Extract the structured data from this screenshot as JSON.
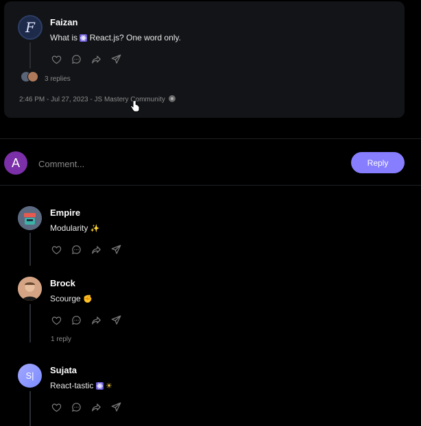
{
  "thread": {
    "author": "Faizan",
    "avatar_letter": "F",
    "text_before": "What is",
    "text_after": "React.js? One word only.",
    "replies_label": "3 replies",
    "meta_label": "2:46 PM - Jul 27, 2023 - JS Mastery Community"
  },
  "comment_form": {
    "avatar_letter": "A",
    "placeholder": "Comment...",
    "button_label": "Reply"
  },
  "replies": [
    {
      "author": "Empire",
      "text": "Modularity",
      "emoji_icon": "sparkles-icon"
    },
    {
      "author": "Brock",
      "text": "Scourge",
      "emoji_icon": "fist-icon",
      "replies_label": "1 reply"
    },
    {
      "author": "Sujata",
      "text": "React-tastic",
      "avatar_text": "S|",
      "emoji_icon": "react-sun-icon"
    }
  ],
  "colors": {
    "accent": "#877eff",
    "card_bg": "#121417",
    "thread_line": "#2a2d33",
    "comment_avatar": "#7b2fa8",
    "muted_text": "#8b8b8b"
  }
}
